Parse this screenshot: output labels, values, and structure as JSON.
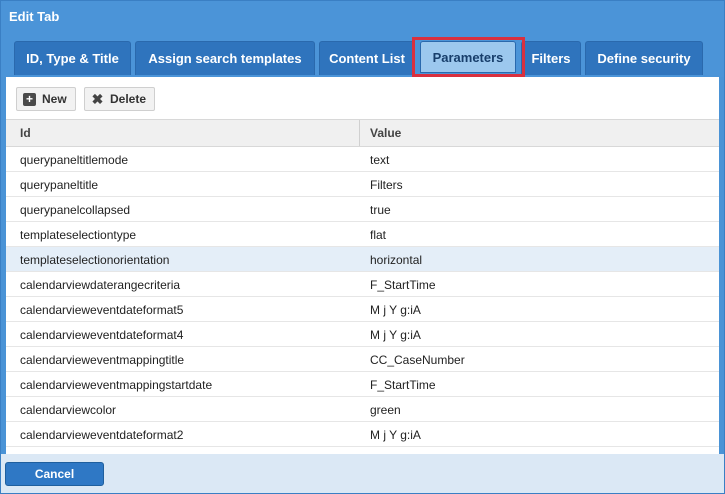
{
  "window": {
    "title": "Edit Tab"
  },
  "tabs": [
    {
      "label": "ID, Type & Title"
    },
    {
      "label": "Assign search templates"
    },
    {
      "label": "Content List"
    },
    {
      "label": "Parameters"
    },
    {
      "label": "Filters"
    },
    {
      "label": "Define security"
    }
  ],
  "active_tab": "Parameters",
  "toolbar": {
    "new_label": "New",
    "delete_label": "Delete"
  },
  "grid": {
    "columns": [
      "Id",
      "Value"
    ],
    "rows": [
      {
        "id": "querypaneltitlemode",
        "value": "text"
      },
      {
        "id": "querypaneltitle",
        "value": "Filters"
      },
      {
        "id": "querypanelcollapsed",
        "value": "true"
      },
      {
        "id": "templateselectiontype",
        "value": "flat"
      },
      {
        "id": "templateselectionorientation",
        "value": "horizontal"
      },
      {
        "id": "calendarviewdaterangecriteria",
        "value": "F_StartTime"
      },
      {
        "id": "calendarvieweventdateformat5",
        "value": "M j Y g:iA"
      },
      {
        "id": "calendarvieweventdateformat4",
        "value": "M j Y g:iA"
      },
      {
        "id": "calendarvieweventmappingtitle",
        "value": "CC_CaseNumber"
      },
      {
        "id": "calendarvieweventmappingstartdate",
        "value": "F_StartTime"
      },
      {
        "id": "calendarviewcolor",
        "value": "green"
      },
      {
        "id": "calendarvieweventdateformat2",
        "value": "M j Y g:iA"
      }
    ],
    "highlighted_row": "templateselectionorientation"
  },
  "footer": {
    "cancel_label": "Cancel"
  },
  "colors": {
    "titlebar": "#4b94d8",
    "tab": "#2f74bd",
    "tab_active": "#9cc8ee",
    "highlight_box": "#d9303e",
    "row_highlight": "#e4eef8"
  }
}
